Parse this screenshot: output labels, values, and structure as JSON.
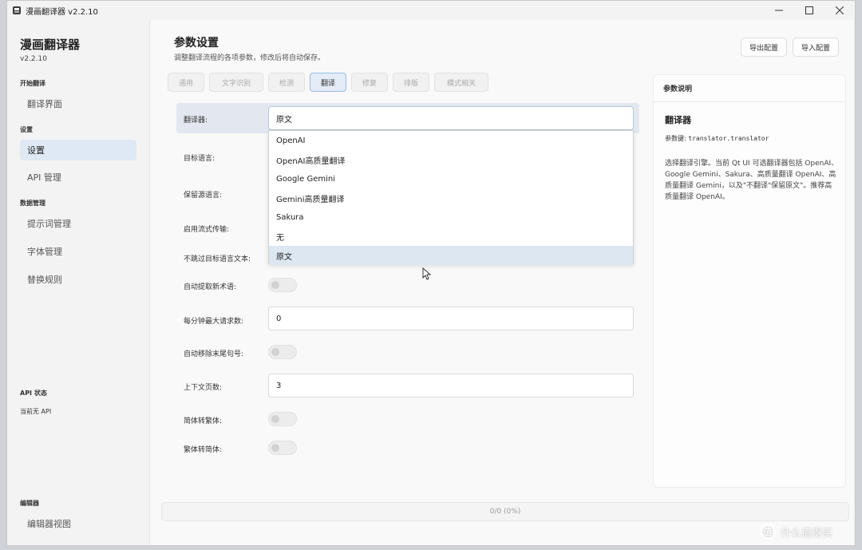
{
  "window": {
    "title": "漫画翻译器 v2.2.10"
  },
  "sidebar": {
    "app_name": "漫画翻译器",
    "version": "v2.2.10",
    "sections": [
      "开始翻译",
      "设置",
      "数据管理",
      "编辑器"
    ],
    "items": [
      "翻译界面",
      "设置",
      "API 管理",
      "提示词管理",
      "字体管理",
      "替换规则",
      "编辑器视图"
    ],
    "api_status_title": "API 状态",
    "api_status_value": "当前无 API"
  },
  "header": {
    "title": "参数设置",
    "subtitle": "调整翻译流程的各项参数，修改后将自动保存。",
    "export_label": "导出配置",
    "import_label": "导入配置"
  },
  "tabs": [
    "通用",
    "文字识别",
    "检测",
    "翻译",
    "修复",
    "排版",
    "模式相关"
  ],
  "active_tab": "翻译",
  "form": {
    "translator_label": "翻译器:",
    "translator_value": "原文",
    "target_lang_label": "目标语言:",
    "keep_lang_label": "保留源语言:",
    "stream_label": "启用流式传输:",
    "skip_target_label": "不跳过目标语言文本:",
    "auto_extract_label": "自动提取新术语:",
    "max_rpm_label": "每分钟最大请求数:",
    "max_rpm_value": "0",
    "remove_punct_label": "自动移除末尾句号:",
    "context_pages_label": "上下文页数:",
    "context_pages_value": "3",
    "s2t_label": "简体转繁体:",
    "t2s_label": "繁体转简体:"
  },
  "dropdown": {
    "options": [
      "OpenAI",
      "OpenAI高质量翻译",
      "Google Gemini",
      "Gemini高质量翻译",
      "Sakura",
      "无",
      "原文"
    ],
    "selected": "原文"
  },
  "panel": {
    "header": "参数说明",
    "title": "翻译器",
    "key_label": "参数键:",
    "key_value": "translator.translator",
    "description": "选择翻译引擎。当前 Qt UI 可选翻译器包括 OpenAI、Google Gemini、Sakura、高质量翻译 OpenAI、高质量翻译 Gemini，以及\"不翻译\"保留原文\"。推荐高质量翻译 OpenAI。"
  },
  "progress": {
    "text": "0/0 (0%)"
  },
  "watermark": {
    "text": "什么值得买",
    "logo_glyph": "值"
  },
  "colors": {
    "accent": "#dfe9f5",
    "tab_active_border": "#9cbde6"
  }
}
